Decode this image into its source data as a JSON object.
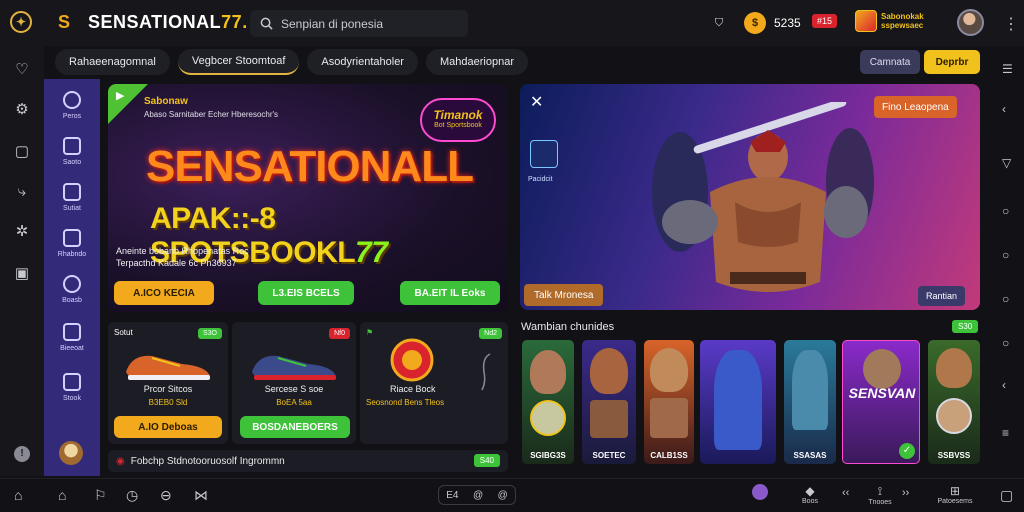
{
  "app": {
    "brand": "SENSATIONAL",
    "brand_accent": "77."
  },
  "search": {
    "placeholder": "Senpian di ponesia"
  },
  "topbar": {
    "balance": "5235",
    "red_badge": "#15",
    "promo_line1": "Sabonokak",
    "promo_line2": "sspewsaec"
  },
  "tabs": [
    {
      "label": "Rahaeenagomnal"
    },
    {
      "label": "Vegbcer Stoomtoaf"
    },
    {
      "label": "Asodyrientaholer"
    },
    {
      "label": "Mahdaeriopnar"
    }
  ],
  "buttons": {
    "compare": "Camnata",
    "deposit": "Deprbr"
  },
  "sidebar": {
    "items": [
      {
        "label": "Peros",
        "icon": "compass-icon"
      },
      {
        "label": "Saoto",
        "icon": "ticket-icon"
      },
      {
        "label": "Sutiat",
        "icon": "image-icon"
      },
      {
        "label": "Rhabndo",
        "icon": "folder-icon"
      },
      {
        "label": "Boasb",
        "icon": "target-icon"
      },
      {
        "label": "Bieeoat",
        "icon": "building-icon"
      },
      {
        "label": "Stook",
        "icon": "chart-icon"
      }
    ]
  },
  "hero": {
    "brand": "Sabonaw",
    "subtitle": "Abaso Sarnitaber Echer Hberesochr's",
    "badge_line1": "Timanok",
    "badge_line2": "Bot Sportsbook",
    "title": "SENSATIONALL",
    "title2_main": "APAK::-8 SPOTSBOOKL",
    "title2_accent": "77",
    "desc1": "Aneinte bobanb Rhopenatas Roc",
    "desc2": "Terpacthd Kadale 6c Ph36937",
    "btn_yellow": "A.ICO KECIA",
    "btn_green1": "L3.EIS BCELS",
    "btn_green2": "BA.EIT IL Eoks"
  },
  "feature": {
    "tag_top": "Fino Leaopena",
    "tag_bottom": "Talk Mronesa",
    "tag_right": "Rantian",
    "side_label": "Pacidcit"
  },
  "cards": [
    {
      "tag": "Sotut",
      "badge": "S3O",
      "name": "Prcor Sitcos",
      "price": "B3EB0 Sld",
      "btn": "A.IO Deboas",
      "badge_color": "#3ec23a",
      "btn_color": "#f2a91c"
    },
    {
      "tag": "",
      "badge": "Nf0",
      "name": "Sercese S soe",
      "price": "BoEA 5aa",
      "btn": "BOSDANEBOERS",
      "badge_color": "#d9242e",
      "btn_color": "#3ec23a"
    },
    {
      "tag": "",
      "badge": "Nd2",
      "name": "Riace Bock",
      "price": "Seosnond Bens Tleos",
      "btn": "",
      "badge_color": "#3ec23a",
      "btn_color": ""
    }
  ],
  "bottom_note": {
    "text": "Fobchp Stdnotooruosolf Ingrommn",
    "badge": "S40"
  },
  "characters": {
    "title": "Wambian chunides",
    "badge": "S30",
    "items": [
      {
        "label": "SGIBG3S"
      },
      {
        "label": "SOETEC"
      },
      {
        "label": "CALB1SS"
      },
      {
        "label": ""
      },
      {
        "label": "SSASAS"
      },
      {
        "label": "SENSVAN"
      },
      {
        "label": "SSBVSS"
      }
    ]
  },
  "bottombar": {
    "items": [
      {
        "label": "Boos"
      },
      {
        "label": "Tnooes"
      },
      {
        "label": "Patoesems"
      }
    ],
    "center": [
      "E4",
      "@",
      "@"
    ]
  }
}
